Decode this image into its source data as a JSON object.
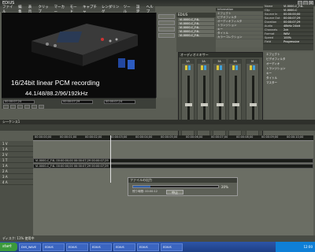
{
  "window": {
    "title": "EDIUS",
    "close_glyph": "×"
  },
  "menu": [
    "ファイル",
    "編集",
    "表示",
    "クリップ",
    "マーカー",
    "モード",
    "キャプチャ",
    "レンダリング",
    "ツール",
    "設定",
    "ヘルプ"
  ],
  "player": {
    "caption_line1": "16/24bit linear PCM recording",
    "caption_line2": "44.1/48/88.2/96/192kHz",
    "timecodes": [
      "00:00:07;24",
      "00:00:07;29",
      "00:00:07;24"
    ]
  },
  "fileinfo": {
    "header": "EDIUS",
    "rows": [
      "VI-0000-C_F4L",
      "VI-0000-C_F4L",
      "VI-0000-C_F4L",
      "VI-0000-C_F4L",
      "VI-0000-C_F4L"
    ]
  },
  "props": {
    "header": "Information",
    "lines": [
      "エフェクト",
      "ビデオフィルタ",
      "オーディオフィルタ",
      "トランジション",
      "キー",
      "タイトル",
      "カラーコレクション",
      "アルファ"
    ]
  },
  "info_table": {
    "rows": [
      {
        "k": "Name",
        "v": "VI-0000-C_F4L"
      },
      {
        "k": "Clip",
        "v": "VI-0000-C"
      },
      {
        "k": "Source In",
        "v": "00:00:00;00"
      },
      {
        "k": "Source Out",
        "v": "00:00:07;29"
      },
      {
        "k": "Duration",
        "v": "00:00:07;29"
      },
      {
        "k": "Audio",
        "v": "48kHz 24bit"
      },
      {
        "k": "Channels",
        "v": "2ch"
      },
      {
        "k": "Format",
        "v": "WAV"
      },
      {
        "k": "Speed",
        "v": "100%"
      },
      {
        "k": "Field",
        "v": "Progressive"
      }
    ]
  },
  "mixer": {
    "header": "オーディオミキサー",
    "channels": [
      "1A",
      "2A",
      "3A",
      "4A",
      "M"
    ]
  },
  "master": {
    "rows": [
      "エフェクト",
      "ビデオフィルタ",
      "オーディオ",
      "トランジション",
      "キー",
      "タイトル",
      "マスター"
    ]
  },
  "timeline": {
    "tab": "シーケンス1",
    "ruler_ticks": [
      "00:00:00;00",
      "00:00:01;00",
      "00:00:02;00",
      "00:00:03;00",
      "00:00:04;00",
      "00:00:05;00",
      "00:00:06;00",
      "00:00:07;00",
      "00:00:08;00",
      "00:00:09;00",
      "00:00:10;00"
    ],
    "tracks": [
      "1 V",
      "1 A",
      "2 V",
      "1 T",
      "1 A",
      "2 A",
      "3 A",
      "4 A"
    ],
    "clip_label": "VI-0000-C_F4L  00:00:00;00  00:00:07;29  00:00:07;29"
  },
  "dialog": {
    "title": "ファイルの出力",
    "progress_pct": 20,
    "pct_text": "20%",
    "remain": "残り時間: 00:00:12",
    "cancel": "中止"
  },
  "status": "ディスク: 11% 使用中",
  "taskbar": {
    "start": "start",
    "buttons": [
      "DVS_WAVE",
      "EDIUS",
      "EDIUS",
      "EDIUS",
      "EDIUS",
      "EDIUS",
      "EDIUS"
    ],
    "clock": "12:00"
  }
}
